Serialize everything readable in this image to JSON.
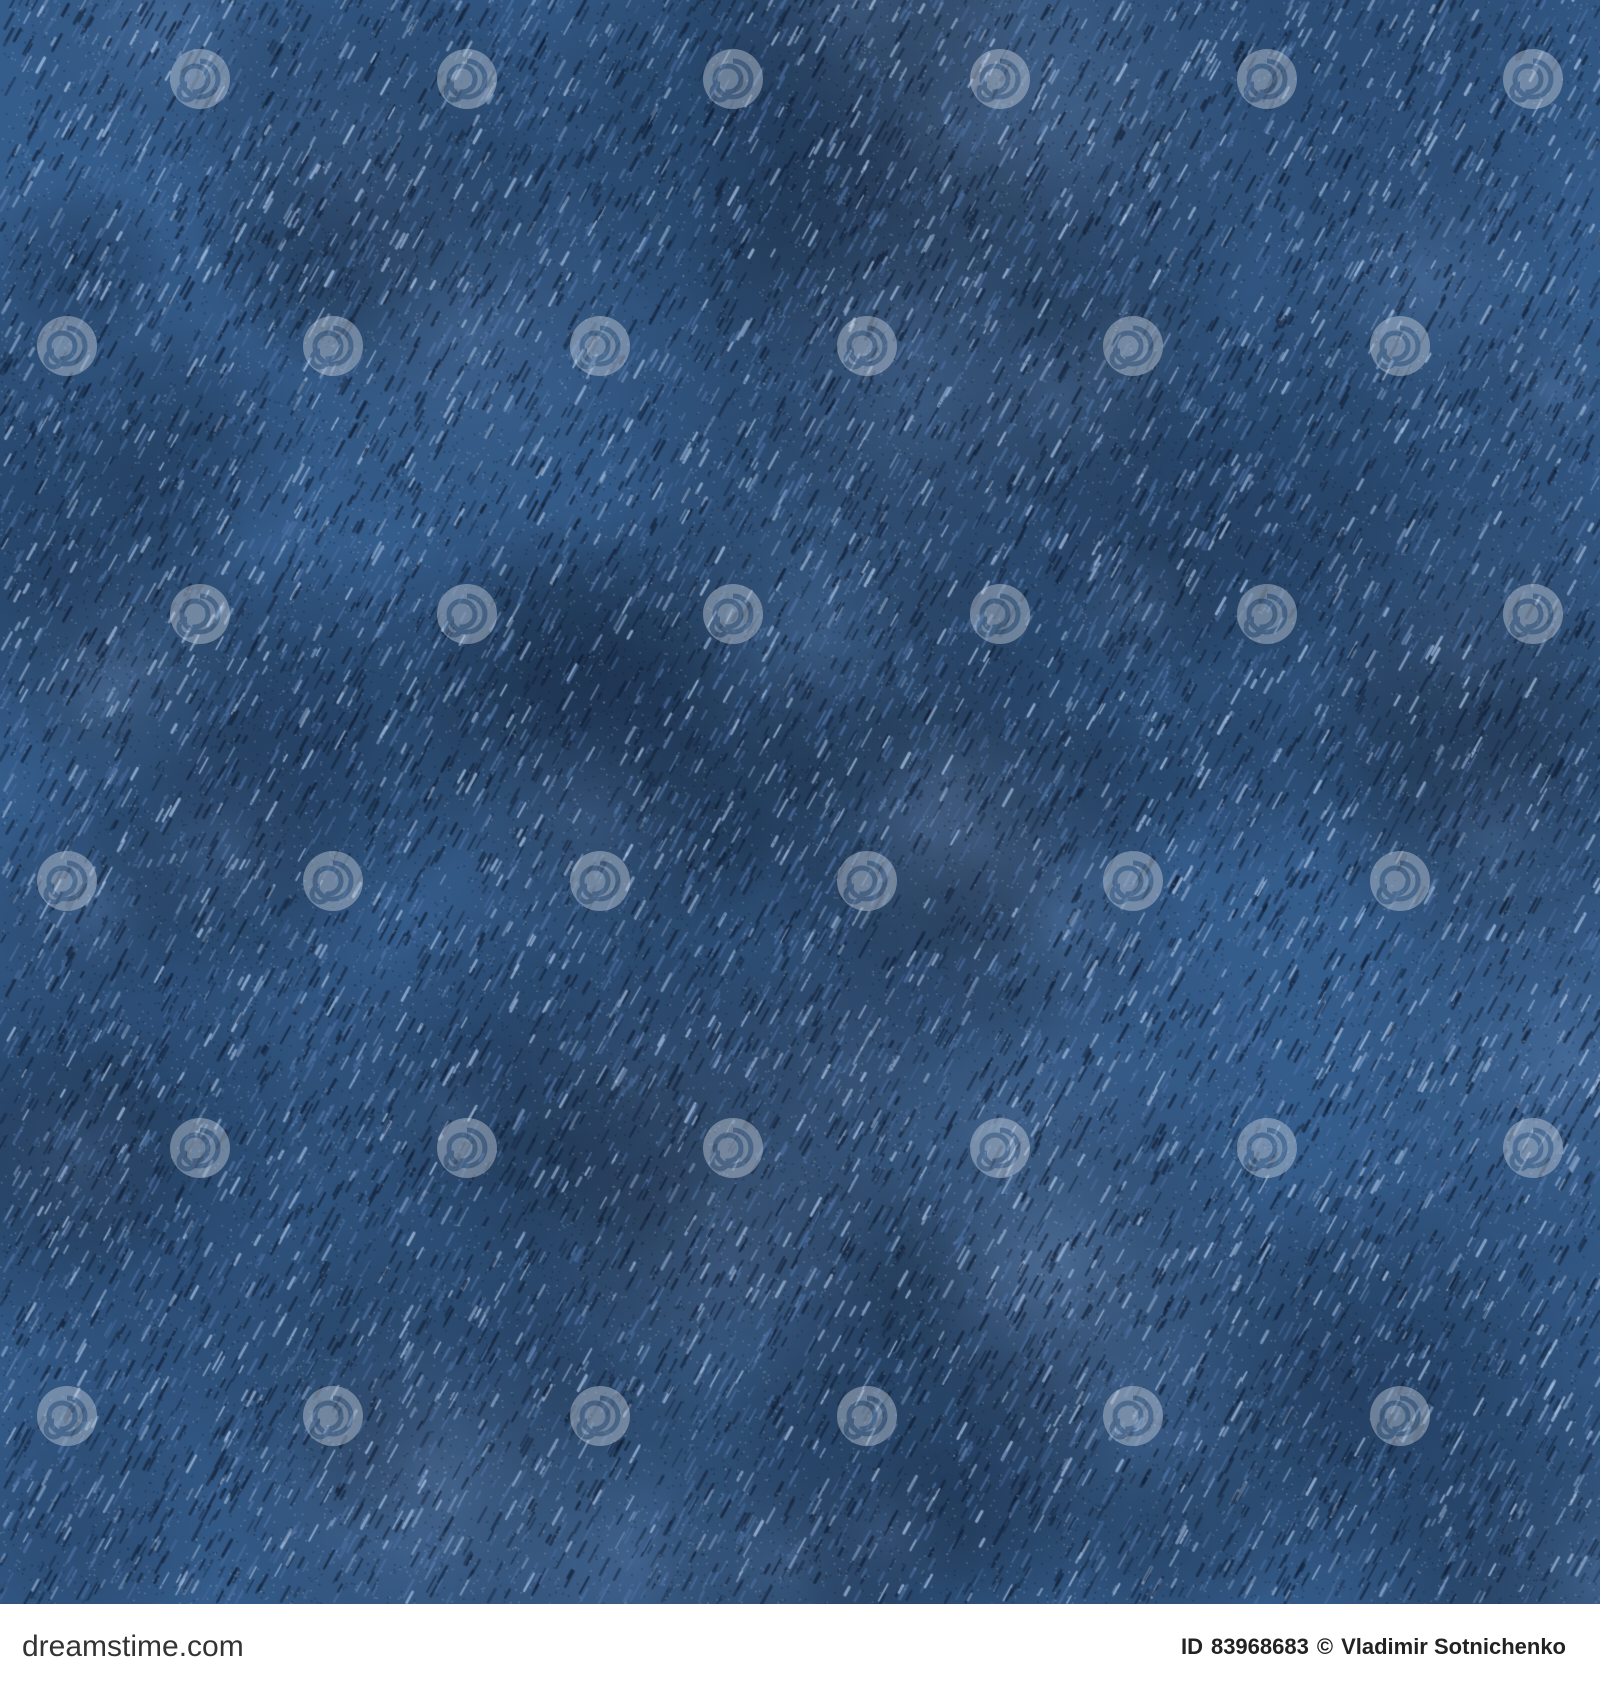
{
  "photo": {
    "subject": "blue denim fabric texture",
    "colors": {
      "base": "#355d8c",
      "dark": "#1d3452",
      "light": "#9bb5d6",
      "watermark": "#cfd6df"
    },
    "watermark_icon": "swirl-watermark-icon",
    "watermark_grid": {
      "rows": 6,
      "cols": 6
    }
  },
  "footer": {
    "brand": "dreamstime.com",
    "id_label": "ID",
    "id_value": "83968683",
    "copyright_symbol": "©",
    "author": "Vladimir Sotnichenko"
  }
}
